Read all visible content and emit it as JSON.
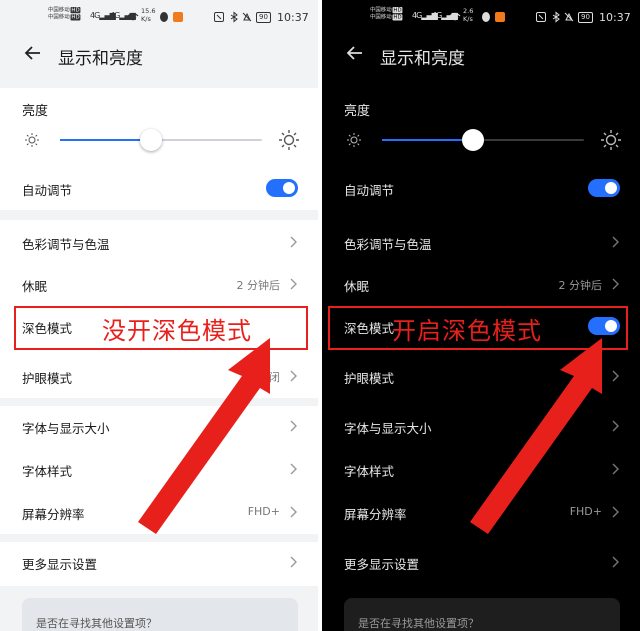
{
  "light": {
    "status": {
      "carrier_top": "中国移动",
      "carrier_bottom": "中国移动",
      "hd1": "HD",
      "hd2": "HD",
      "net1": "4G",
      "net2": "4G",
      "speed_value": "15.6",
      "speed_unit": "K/s",
      "battery": "90",
      "time": "10:37"
    },
    "title": "显示和亮度",
    "brightness_label": "亮度",
    "brightness_level": 0.45,
    "rows": {
      "auto_adjust": "自动调节",
      "color_temp": "色彩调节与色温",
      "sleep": "休眠",
      "sleep_value": "2 分钟后",
      "dark_mode": "深色模式",
      "eye_comfort": "护眼模式",
      "eye_comfort_value": "关闭",
      "font_size": "字体与显示大小",
      "font_style": "字体样式",
      "resolution": "屏幕分辨率",
      "resolution_value": "FHD+",
      "more_display": "更多显示设置",
      "search_hint": "是否在寻找其他设置项？"
    },
    "annotation": "没开深色模式"
  },
  "dark": {
    "status": {
      "carrier_top": "中国移动",
      "carrier_bottom": "中国移动",
      "hd1": "HD",
      "hd2": "HD",
      "net1": "4G",
      "net2": "4G",
      "speed_value": "2.6",
      "speed_unit": "K/s",
      "battery": "90",
      "time": "10:37"
    },
    "title": "显示和亮度",
    "brightness_label": "亮度",
    "brightness_level": 0.45,
    "rows": {
      "auto_adjust": "自动调节",
      "color_temp": "色彩调节与色温",
      "sleep": "休眠",
      "sleep_value": "2 分钟后",
      "dark_mode": "深色模式",
      "eye_comfort": "护眼模式",
      "eye_comfort_value": "关闭",
      "font_size": "字体与显示大小",
      "font_style": "字体样式",
      "resolution": "屏幕分辨率",
      "resolution_value": "FHD+",
      "more_display": "更多显示设置",
      "search_hint": "是否在寻找其他设置项？"
    },
    "annotation": "开启深色模式"
  },
  "colors": {
    "accent": "#256fff",
    "annotation_red": "#e8201c",
    "light_card": "#ffffff",
    "light_bg": "#f1f3f5",
    "dark_card": "#000000",
    "dark_bg": "#000000"
  },
  "icons": [
    "back-arrow-icon",
    "sun-small-icon",
    "sun-large-icon",
    "chevron-right-icon",
    "signal-icon",
    "wifi-icon",
    "nfc-icon",
    "mute-icon",
    "bluetooth-icon",
    "battery-icon"
  ]
}
